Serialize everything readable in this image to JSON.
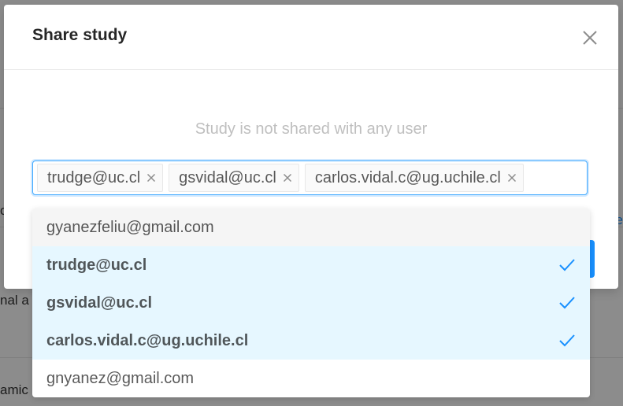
{
  "background": {
    "row_texts": [
      "o",
      "nal a",
      "amic"
    ]
  },
  "modal": {
    "title": "Share study",
    "empty_message": "Study is not shared with any user"
  },
  "selected_tags": [
    {
      "label": "trudge@uc.cl"
    },
    {
      "label": "gsvidal@uc.cl"
    },
    {
      "label": "carlos.vidal.c@ug.uchile.cl"
    }
  ],
  "dropdown_options": [
    {
      "label": "gyanezfeliu@gmail.com",
      "selected": false
    },
    {
      "label": "trudge@uc.cl",
      "selected": true
    },
    {
      "label": "gsvidal@uc.cl",
      "selected": true
    },
    {
      "label": "carlos.vidal.c@ug.uchile.cl",
      "selected": true
    },
    {
      "label": "gnyanez@gmail.com",
      "selected": false
    }
  ],
  "colors": {
    "accent": "#1890ff",
    "selected_bg": "#e6f7ff",
    "hover_bg": "#f5f5f5"
  },
  "icons": {
    "close": "close-icon",
    "tag_remove": "tag-remove-icon",
    "check": "check-icon"
  }
}
